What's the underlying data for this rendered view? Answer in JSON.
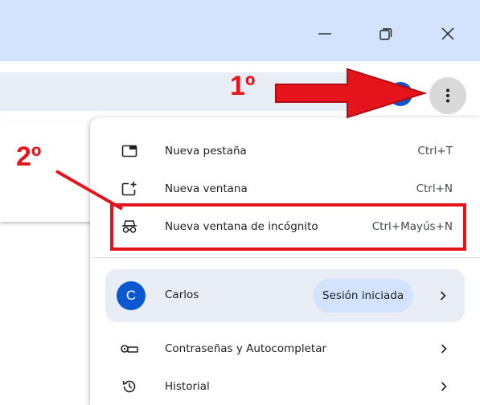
{
  "window_controls": {
    "minimize": "minimize-icon",
    "restore": "restore-icon",
    "close": "close-icon"
  },
  "toolbar": {
    "profile_initial": "C",
    "bookmark_icon": "star-icon",
    "menu_icon": "more-vert-icon"
  },
  "menu": {
    "items": [
      {
        "label": "Nueva pestaña",
        "shortcut": "Ctrl+T",
        "icon": "new-tab-icon"
      },
      {
        "label": "Nueva ventana",
        "shortcut": "Ctrl+N",
        "icon": "new-window-icon"
      },
      {
        "label": "Nueva ventana de incógnito",
        "shortcut": "Ctrl+Mayús+N",
        "icon": "incognito-icon"
      }
    ],
    "profile": {
      "initial": "C",
      "name": "Carlos",
      "status": "Sesión iniciada"
    },
    "lower_items": [
      {
        "label": "Contraseñas y Autocompletar",
        "icon": "key-icon"
      },
      {
        "label": "Historial",
        "icon": "history-icon"
      }
    ]
  },
  "annotations": {
    "step1": "1º",
    "step2": "2º",
    "color": "#e5141c"
  },
  "colors": {
    "titlebar": "#d3e3fd",
    "omnibox": "#e9eef6",
    "accent": "#0b57d0",
    "chip": "#d3e3fd"
  }
}
